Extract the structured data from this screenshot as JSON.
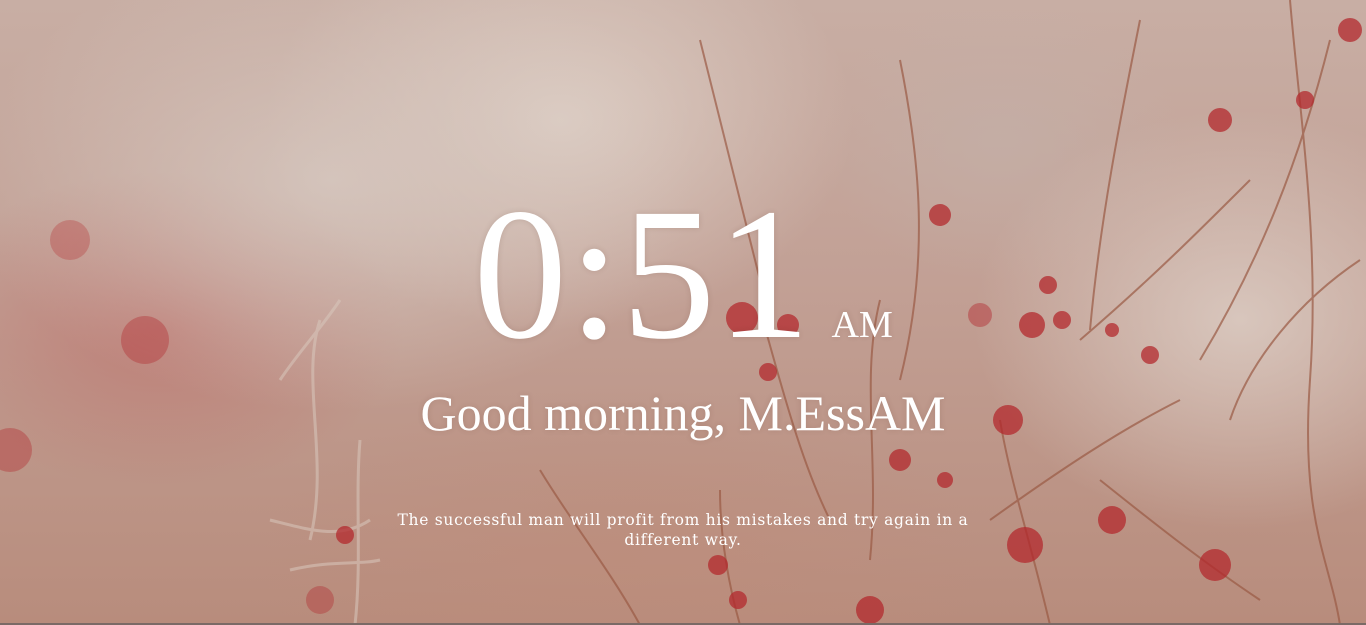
{
  "clock": {
    "time": "0:51",
    "period": "AM"
  },
  "greeting": {
    "text": "Good morning, M.EssAM"
  },
  "quote": {
    "text": "The successful man will profit from his mistakes and try again in a different way."
  },
  "theme": {
    "text_color": "#ffffff",
    "background": "blurred photo of red-budded branches"
  }
}
